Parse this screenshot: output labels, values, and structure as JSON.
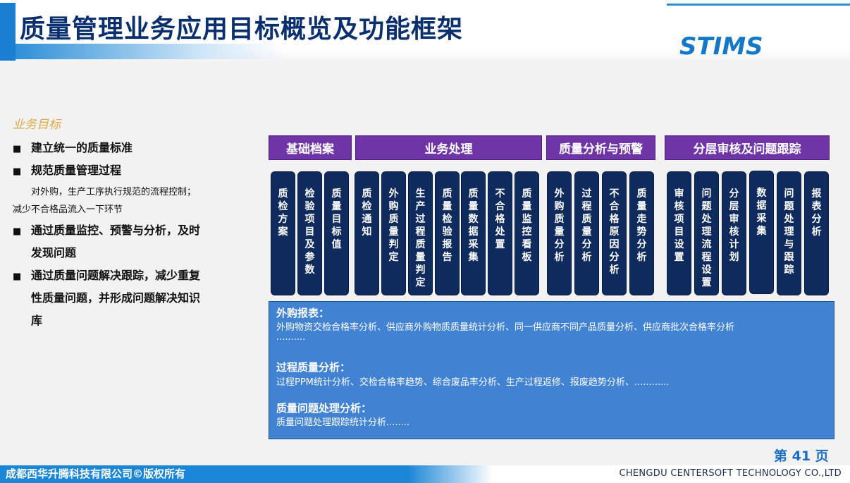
{
  "header": {
    "title": "质量管理业务应用目标概览及功能框架",
    "logo": "STIMS"
  },
  "goals": {
    "title": "业务目标",
    "items": [
      "建立统一的质量标准",
      "规范质量管理过程",
      "通过质量监控、预警与分析，及时",
      "通过质量问题解决跟踪，减少重复"
    ],
    "item2_sub1": "对外购，生产工序执行规范的流程控制；",
    "item2_sub2": "减少不合格品流入一下环节",
    "item3_line2": "发现问题",
    "item4_line2": "性质量问题，并形成问题解决知识",
    "item4_line3": "库"
  },
  "chart_data": {
    "type": "table",
    "categories": [
      {
        "name": "基础档案",
        "items": [
          "质检方案",
          "检验项目及参数",
          "质量目标值"
        ]
      },
      {
        "name": "业务处理",
        "items": [
          "质检通知",
          "外购质量判定",
          "生产过程质量判定",
          "质量检验报告",
          "质量数据采集",
          "不合格处置",
          "质量监控看板"
        ]
      },
      {
        "name": "质量分析与预警",
        "items": [
          "外购质量分析",
          "过程质量分析",
          "不合格原因分析",
          "质量走势分析"
        ]
      },
      {
        "name": "分层审核及问题跟踪",
        "items": [
          "审核项目设置",
          "问题处理流程设置",
          "分层审核计划",
          "数据采集",
          "问题处理与跟踪",
          "报表分析"
        ]
      }
    ],
    "reports": [
      {
        "heading": "外购报表：",
        "text": "外购物资交检合格率分析、供应商外购物质质量统计分析、同一供应商不同产品质量分析、供应商批次合格率分析",
        "text2": ".........."
      },
      {
        "heading": "过程质量分析：",
        "text": "过程PPM统计分析、交检合格率趋势、综合废品率分析、生产过程返修、报废趋势分析、............"
      },
      {
        "heading": "质量问题处理分析：",
        "text": "质量问题处理跟踪统计分析........"
      }
    ]
  },
  "footer": {
    "page": "第 41 页",
    "copyright": "成都西华升腾科技有限公司©版权所有",
    "company_en": "CHENGDU CENTERSOFT TECHNOLOGY CO.,LTD"
  }
}
